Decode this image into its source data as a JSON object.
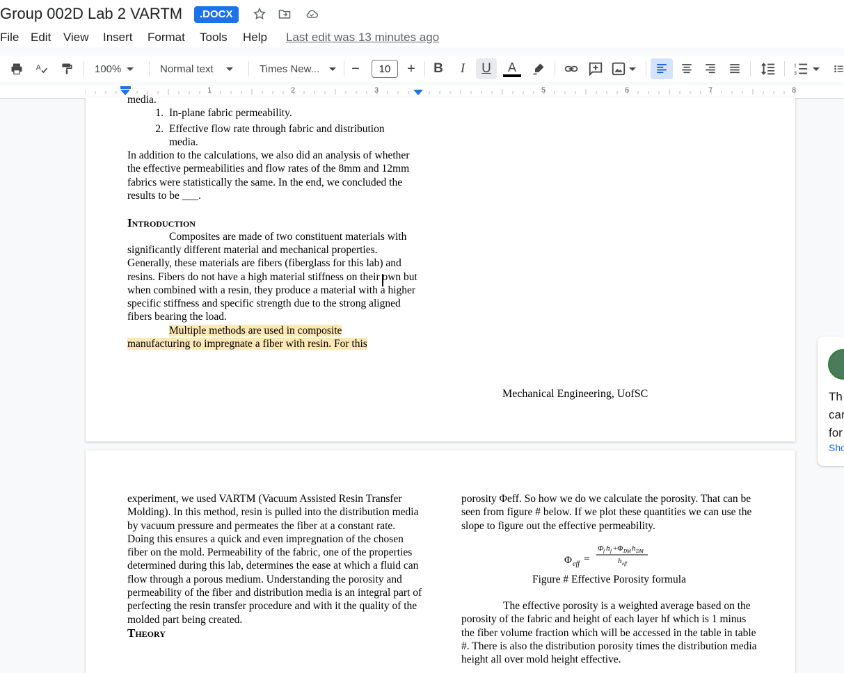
{
  "app": {
    "doc_title": "Group 002D Lab 2 VARTM",
    "file_type_badge": ".DOCX"
  },
  "menu": {
    "items": [
      "File",
      "Edit",
      "View",
      "Insert",
      "Format",
      "Tools",
      "Help"
    ],
    "last_edit": "Last edit was 13 minutes ago"
  },
  "toolbar": {
    "zoom": "100%",
    "style": "Normal text",
    "font": "Times New...",
    "font_size": "10"
  },
  "ruler": {
    "numbers": [
      "1",
      "2",
      "3",
      "5",
      "6",
      "7",
      "8"
    ]
  },
  "page1": {
    "cut_line": "media.",
    "list": [
      {
        "num": "1.",
        "text": "In-plane fabric permeability."
      },
      {
        "num": "2.",
        "text": "Effective flow rate through fabric and distribution media."
      }
    ],
    "para_analysis": "In addition to the calculations, we also did an analysis of whether the effective permeabilities and flow rates of the 8mm and 12mm fabrics were statistically the same. In the end, we concluded the results to be ___.",
    "intro_heading": "Introduction",
    "intro_para": "Composites are made of two constituent materials with significantly different material and mechanical properties. Generally, these materials are fibers (fiberglass for this lab) and resins. Fibers do not have a high material stiffness on their own but when combined with a resin, they produce a material with a higher specific stiffness and specific strength due to the strong aligned fibers bearing the load.",
    "highlight_para": "Multiple methods are used in composite manufacturing to impregnate a fiber with resin. For this",
    "footer": "Mechanical Engineering, UofSC"
  },
  "page2": {
    "left_para": "experiment, we used VARTM (Vacuum Assisted Resin Transfer Molding). In this method, resin is pulled into the distribution media by vacuum pressure and permeates the fiber at a constant rate. Doing this ensures a quick and even impregnation of the chosen fiber on the mold. Permeability of the fabric, one of the properties determined during this lab, determines the ease at which a fluid can flow through a porous medium.  Understanding the porosity and permeability of the fiber and distribution media is an integral part of perfecting the resin transfer procedure and with it the quality of the molded part being created.",
    "theory_heading": "Theory",
    "right_para1": "porosity Φeff. So how we do we calculate the porosity. That can be seen from figure # below. If we plot these quantities we can use the slope to figure out the effective permeability.",
    "formula_lhs": "Φ",
    "formula_lhs_sub": "eff",
    "formula_num": "Φᵣhᵣ+Φ",
    "formula_caption": "Figure # Effective Porosity formula",
    "right_para2": "The effective porosity is a weighted average based on the porosity of the fabric and height of each layer hf which is 1 minus the fiber volume fraction which will be accessed in the table in table #. There is also the distribution porosity times the distribution media height all over mold height effective."
  },
  "comment": {
    "lines": [
      "Th",
      "car",
      "for"
    ],
    "link": "Sho"
  }
}
